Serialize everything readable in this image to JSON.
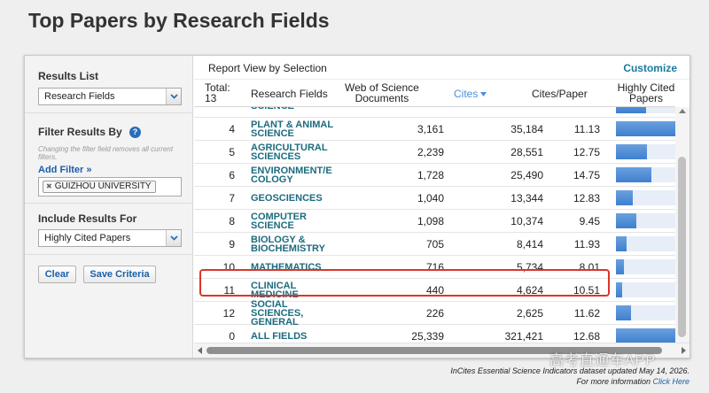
{
  "page_title": "Top Papers by Research Fields",
  "sidebar": {
    "results_list": {
      "title": "Results List",
      "selected": "Research Fields"
    },
    "filter": {
      "title": "Filter Results By",
      "hint": "Changing the filter field removes all current filters.",
      "add_filter_label": "Add Filter »",
      "chip_remove": "✖",
      "chip_label": "GUIZHOU UNIVERSITY"
    },
    "include": {
      "title": "Include Results For",
      "selected": "Highly Cited Papers"
    },
    "clear_label": "Clear",
    "save_label": "Save Criteria"
  },
  "report": {
    "title": "Report View by Selection",
    "customize_label": "Customize",
    "columns": {
      "total": "Total:",
      "total_count": "13",
      "field": "Research Fields",
      "docs_line1": "Web of Science",
      "docs_line2": "Documents",
      "cites": "Cites",
      "cites_per_paper": "Cites/Paper",
      "highly_cited_line1": "Highly Cited",
      "highly_cited_line2": "Papers"
    },
    "rows": [
      {
        "rank": "",
        "field_line1": "SCIENCE",
        "field_line2": "",
        "docs": "",
        "cites": "",
        "cpp": "",
        "hc_fraction": 0.5
      },
      {
        "rank": "4",
        "field_line1": "PLANT & ANIMAL",
        "field_line2": "SCIENCE",
        "docs": "3,161",
        "cites": "35,184",
        "cpp": "11.13",
        "hc_fraction": 1.0
      },
      {
        "rank": "5",
        "field_line1": "AGRICULTURAL",
        "field_line2": "SCIENCES",
        "docs": "2,239",
        "cites": "28,551",
        "cpp": "12.75",
        "hc_fraction": 0.52
      },
      {
        "rank": "6",
        "field_line1": "ENVIRONMENT/E",
        "field_line2": "COLOGY",
        "docs": "1,728",
        "cites": "25,490",
        "cpp": "14.75",
        "hc_fraction": 0.6
      },
      {
        "rank": "7",
        "field_line1": "GEOSCIENCES",
        "field_line2": "",
        "docs": "1,040",
        "cites": "13,344",
        "cpp": "12.83",
        "hc_fraction": 0.28
      },
      {
        "rank": "8",
        "field_line1": "COMPUTER",
        "field_line2": "SCIENCE",
        "docs": "1,098",
        "cites": "10,374",
        "cpp": "9.45",
        "hc_fraction": 0.34
      },
      {
        "rank": "9",
        "field_line1": "BIOLOGY &",
        "field_line2": "BIOCHEMISTRY",
        "docs": "705",
        "cites": "8,414",
        "cpp": "11.93",
        "hc_fraction": 0.18
      },
      {
        "rank": "10",
        "field_line1": "MATHEMATICS",
        "field_line2": "",
        "docs": "716",
        "cites": "5,734",
        "cpp": "8.01",
        "hc_fraction": 0.13
      },
      {
        "rank": "11",
        "field_line1": "CLINICAL",
        "field_line2": "MEDICINE",
        "docs": "440",
        "cites": "4,624",
        "cpp": "10.51",
        "hc_fraction": 0.1
      },
      {
        "rank": "12",
        "field_line1": "SOCIAL",
        "field_line2": "SCIENCES, GENERAL",
        "docs": "226",
        "cites": "2,625",
        "cpp": "11.62",
        "hc_fraction": 0.25
      },
      {
        "rank": "0",
        "field_line1": "ALL FIELDS",
        "field_line2": "",
        "docs": "25,339",
        "cites": "321,421",
        "cpp": "12.68",
        "hc_fraction": 1.0
      }
    ]
  },
  "footer": {
    "line1": "InCites Essential Science Indicators dataset updated May 14, 2026.",
    "line2_prefix": "For more information",
    "line2_link": "Click Here"
  },
  "watermark": "高考直通车APP",
  "colors": {
    "field_text": "#1d6b7e",
    "link": "#1a5fa8",
    "bar": "#3e7fcf",
    "highlight": "#d9362b"
  }
}
